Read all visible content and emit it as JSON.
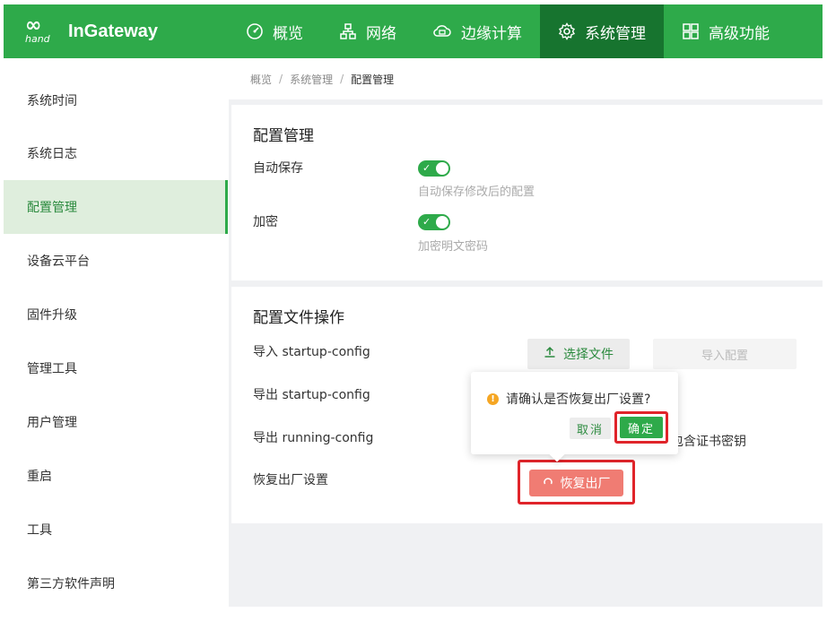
{
  "brand": {
    "logo_mark": "in",
    "logo_sub": "hand",
    "name": "InGateway"
  },
  "nav": {
    "items": [
      {
        "label": "概览",
        "icon": "dashboard-icon"
      },
      {
        "label": "网络",
        "icon": "network-icon"
      },
      {
        "label": "边缘计算",
        "icon": "cloud-compute-icon"
      },
      {
        "label": "系统管理",
        "icon": "gear-icon",
        "active": true
      },
      {
        "label": "高级功能",
        "icon": "grid-icon"
      }
    ]
  },
  "sidebar": {
    "items": [
      {
        "label": "系统时间"
      },
      {
        "label": "系统日志"
      },
      {
        "label": "配置管理",
        "active": true
      },
      {
        "label": "设备云平台"
      },
      {
        "label": "固件升级"
      },
      {
        "label": "管理工具"
      },
      {
        "label": "用户管理"
      },
      {
        "label": "重启"
      },
      {
        "label": "工具"
      },
      {
        "label": "第三方软件声明"
      }
    ]
  },
  "breadcrumb": {
    "items": [
      "概览",
      "系统管理",
      "配置管理"
    ],
    "separator": "/"
  },
  "config_card": {
    "title": "配置管理",
    "auto_save": {
      "label": "自动保存",
      "hint": "自动保存修改后的配置",
      "enabled": true
    },
    "encrypt": {
      "label": "加密",
      "hint": "加密明文密码",
      "enabled": true
    }
  },
  "file_card": {
    "title": "配置文件操作",
    "import_label": "导入 startup-config",
    "export_startup_label": "导出 startup-config",
    "export_running_label": "导出 running-config",
    "factory_label": "恢复出厂设置",
    "choose_file_button": "选择文件",
    "import_button": "导入配置",
    "cert_text": "包含证书密钥",
    "factory_button": "恢复出厂"
  },
  "popconfirm": {
    "message": "请确认是否恢复出厂设置?",
    "cancel_label": "取消",
    "ok_label": "确定"
  },
  "colors": {
    "brand_green": "#2eaa4a",
    "nav_active": "#17742f",
    "danger_red": "#e0242a",
    "factory_button": "#f07c73"
  }
}
